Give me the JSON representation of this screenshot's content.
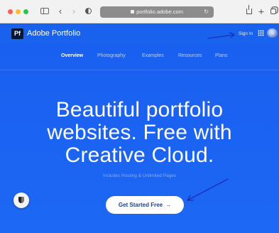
{
  "browser": {
    "url": "portfolio.adobe.com",
    "icons": [
      "sidebar-icon",
      "chevron-left-icon",
      "chevron-right-icon",
      "shield-icon",
      "lock-icon",
      "reload-icon",
      "share-icon",
      "plus-icon",
      "tabs-icon"
    ]
  },
  "header": {
    "logo_text": "Pf",
    "brand": "Adobe Portfolio",
    "signin": "Sign In"
  },
  "nav": {
    "items": [
      {
        "label": "Overview",
        "active": true
      },
      {
        "label": "Photography",
        "active": false
      },
      {
        "label": "Examples",
        "active": false
      },
      {
        "label": "Resources",
        "active": false
      },
      {
        "label": "Plans",
        "active": false
      }
    ]
  },
  "hero": {
    "line1": "Beautiful portfolio",
    "line2": "websites. Free with",
    "line3": "Creative Cloud.",
    "subline": "Includes Hosting & Unlimited Pages"
  },
  "cta": {
    "label": "Get Started Free",
    "arrow": "→"
  },
  "colors": {
    "page_blue": "#1a5ff0",
    "annotation_arrow": "#1a2fb8",
    "cta_text": "#1f3f91"
  }
}
